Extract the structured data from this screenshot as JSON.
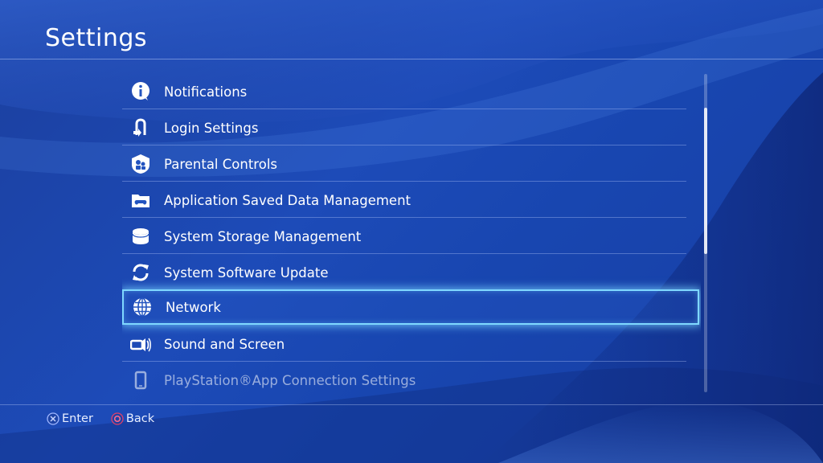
{
  "screen": {
    "title": "Settings"
  },
  "menu": {
    "items": [
      {
        "label": "Notifications",
        "icon": "notifications-icon"
      },
      {
        "label": "Login Settings",
        "icon": "login-icon"
      },
      {
        "label": "Parental Controls",
        "icon": "parental-controls-icon"
      },
      {
        "label": "Application Saved Data Management",
        "icon": "saved-data-icon"
      },
      {
        "label": "System Storage Management",
        "icon": "storage-icon"
      },
      {
        "label": "System Software Update",
        "icon": "update-icon"
      },
      {
        "label": "Network",
        "icon": "network-icon",
        "selected": true
      },
      {
        "label": "Sound and Screen",
        "icon": "sound-screen-icon"
      },
      {
        "label": "PlayStation®App Connection Settings",
        "icon": "phone-icon"
      }
    ]
  },
  "footer": {
    "enter_label": "Enter",
    "enter_button": "cross-button-icon",
    "back_label": "Back",
    "back_button": "circle-button-icon"
  },
  "colors": {
    "background": "#1d4bb8",
    "selection_glow": "#7fd8ff",
    "circle_button": "#e0406a",
    "cross_button": "#9fb6ff"
  }
}
